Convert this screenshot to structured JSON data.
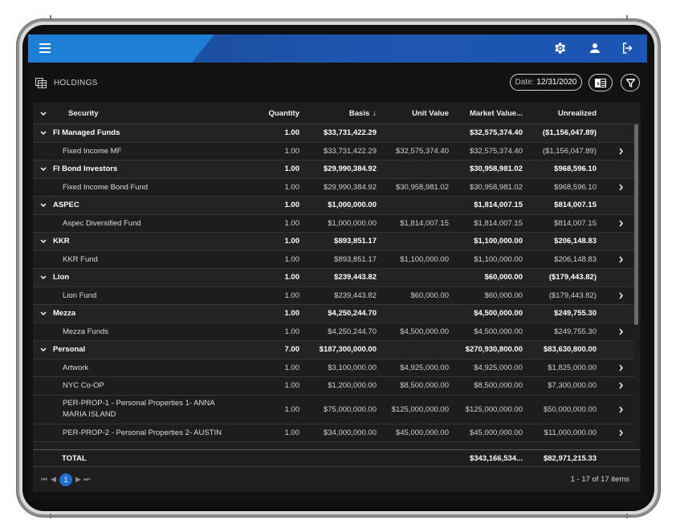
{
  "header": {
    "icons": [
      "menu-icon",
      "settings-gear-icon",
      "user-icon",
      "logout-icon"
    ]
  },
  "page": {
    "title": "HOLDINGS",
    "date_label": "Date:",
    "date_value": "12/31/2020"
  },
  "grid": {
    "columns": {
      "security": "Security",
      "quantity": "Quantity",
      "basis": "Basis",
      "basis_sort": "↓",
      "unit_value": "Unit Value",
      "market_value": "Market Value...",
      "unrealized": "Unrealized"
    },
    "rows": [
      {
        "type": "group",
        "security": "FI Managed Funds",
        "quantity": "1.00",
        "basis": "$33,731,422.29",
        "unit_value": "",
        "market_value": "$32,575,374.40",
        "unrealized": "($1,156,047.89)"
      },
      {
        "type": "detail",
        "security": "Fixed Income MF",
        "quantity": "1.00",
        "basis": "$33,731,422.29",
        "unit_value": "$32,575,374.40",
        "market_value": "$32,575,374.40",
        "unrealized": "($1,156,047.89)"
      },
      {
        "type": "group",
        "security": "FI Bond Investors",
        "quantity": "1.00",
        "basis": "$29,990,384.92",
        "unit_value": "",
        "market_value": "$30,958,981.02",
        "unrealized": "$968,596.10"
      },
      {
        "type": "detail",
        "security": "Fixed Income Bond Fund",
        "quantity": "1.00",
        "basis": "$29,990,384.92",
        "unit_value": "$30,958,981.02",
        "market_value": "$30,958,981.02",
        "unrealized": "$968,596.10"
      },
      {
        "type": "group",
        "security": "ASPEC",
        "quantity": "1.00",
        "basis": "$1,000,000.00",
        "unit_value": "",
        "market_value": "$1,814,007.15",
        "unrealized": "$814,007.15"
      },
      {
        "type": "detail",
        "security": "Aspec Diversified Fund",
        "quantity": "1.00",
        "basis": "$1,000,000.00",
        "unit_value": "$1,814,007.15",
        "market_value": "$1,814,007.15",
        "unrealized": "$814,007.15"
      },
      {
        "type": "group",
        "security": "KKR",
        "quantity": "1.00",
        "basis": "$893,851.17",
        "unit_value": "",
        "market_value": "$1,100,000.00",
        "unrealized": "$206,148.83"
      },
      {
        "type": "detail",
        "security": "KKR Fund",
        "quantity": "1.00",
        "basis": "$893,851.17",
        "unit_value": "$1,100,000.00",
        "market_value": "$1,100,000.00",
        "unrealized": "$206,148.83"
      },
      {
        "type": "group",
        "security": "Lion",
        "quantity": "1.00",
        "basis": "$239,443.82",
        "unit_value": "",
        "market_value": "$60,000.00",
        "unrealized": "($179,443.82)"
      },
      {
        "type": "detail",
        "security": "Lion Fund",
        "quantity": "1.00",
        "basis": "$239,443.82",
        "unit_value": "$60,000.00",
        "market_value": "$60,000.00",
        "unrealized": "($179,443.82)"
      },
      {
        "type": "group",
        "security": "Mezza",
        "quantity": "1.00",
        "basis": "$4,250,244.70",
        "unit_value": "",
        "market_value": "$4,500,000.00",
        "unrealized": "$249,755.30"
      },
      {
        "type": "detail",
        "security": "Mezza Funds",
        "quantity": "1.00",
        "basis": "$4,250,244.70",
        "unit_value": "$4,500,000.00",
        "market_value": "$4,500,000.00",
        "unrealized": "$249,755.30"
      },
      {
        "type": "group",
        "security": "Personal",
        "quantity": "7.00",
        "basis": "$187,300,000.00",
        "unit_value": "",
        "market_value": "$270,930,800.00",
        "unrealized": "$83,630,800.00"
      },
      {
        "type": "detail",
        "security": "Artwork",
        "quantity": "1.00",
        "basis": "$3,100,000.00",
        "unit_value": "$4,925,000.00",
        "market_value": "$4,925,000.00",
        "unrealized": "$1,825,000.00"
      },
      {
        "type": "detail",
        "security": "NYC Co-OP",
        "quantity": "1.00",
        "basis": "$1,200,000.00",
        "unit_value": "$8,500,000.00",
        "market_value": "$8,500,000.00",
        "unrealized": "$7,300,000.00"
      },
      {
        "type": "detail",
        "security": "PER-PROP-1 - Personal Properties 1- ANNA MARIA ISLAND",
        "quantity": "1.00",
        "basis": "$75,000,000.00",
        "unit_value": "$125,000,000.00",
        "market_value": "$125,000,000.00",
        "unrealized": "$50,000,000.00"
      },
      {
        "type": "detail",
        "security": "PER-PROP-2 - Personal Properties 2- AUSTIN",
        "quantity": "1.00",
        "basis": "$34,000,000.00",
        "unit_value": "$45,000,000.00",
        "market_value": "$45,000,000.00",
        "unrealized": "$11,000,000.00"
      }
    ],
    "total": {
      "label": "TOTAL",
      "market_value": "$343,166,534...",
      "unrealized": "$82,971,215.33"
    },
    "pager": {
      "current_page": "1",
      "info": "1 - 17 of 17 items"
    }
  },
  "colors": {
    "accent": "#1f6fd0",
    "header_gradient_start": "#1f7fd6",
    "header_gradient_end": "#1c55b3",
    "background": "#121212"
  }
}
